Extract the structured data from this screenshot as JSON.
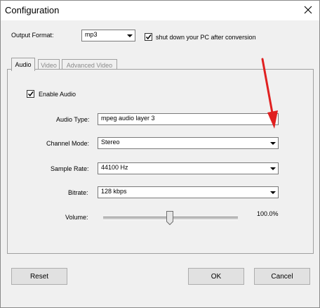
{
  "window": {
    "title": "Configuration"
  },
  "output": {
    "label": "Output Format:",
    "value": "mp3",
    "shutdown_label": "shut down your PC after conversion",
    "shutdown_checked": true
  },
  "tabs": [
    {
      "label": "Audio",
      "active": true
    },
    {
      "label": "Video",
      "active": false
    },
    {
      "label": "Advanced Video",
      "active": false
    }
  ],
  "audio": {
    "enable_label": "Enable Audio",
    "enable_checked": true,
    "audio_type": {
      "label": "Audio Type:",
      "value": "mpeg audio layer 3"
    },
    "channel_mode": {
      "label": "Channel Mode:",
      "value": "Stereo"
    },
    "sample_rate": {
      "label": "Sample Rate:",
      "value": "44100 Hz"
    },
    "bitrate": {
      "label": "Bitrate:",
      "value": "128 kbps"
    },
    "volume": {
      "label": "Volume:",
      "value_text": "100.0%",
      "level": 0.5
    }
  },
  "buttons": {
    "reset": "Reset",
    "ok": "OK",
    "cancel": "Cancel"
  },
  "annotation": {
    "arrow_color": "#e02020"
  }
}
